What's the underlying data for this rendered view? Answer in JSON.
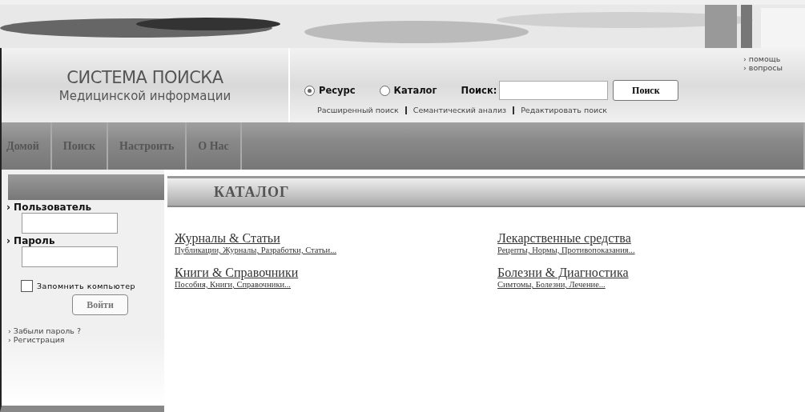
{
  "logo": {
    "title": "СИСТЕМА ПОИСКА",
    "subtitle": "Медицинской информации"
  },
  "help_links": [
    "› помощь",
    "› вопросы"
  ],
  "search": {
    "scopes": [
      {
        "label": "Ресурс",
        "selected": true
      },
      {
        "label": "Каталог",
        "selected": false
      }
    ],
    "label": "Поиск:",
    "button": "Поиск",
    "links": [
      "Расширенный поиск",
      "Семантический анализ",
      "Редактировать поиск"
    ]
  },
  "nav": [
    "Домой",
    "Поиск",
    "Настроить",
    "О Нас"
  ],
  "login": {
    "user_label": "› Пользователь",
    "password_label": "› Пароль",
    "remember": {
      "label": "Запомнить компьютер",
      "checked": false
    },
    "button": "Войти",
    "links": [
      "› Забыли пароль ?",
      "› Регистрация"
    ]
  },
  "catalog": {
    "title": "КАТАЛОГ",
    "items": [
      {
        "title": "Журналы & Статьи",
        "subtitle": "Публикации, Журналы, Разработки, Статьи..."
      },
      {
        "title": "Лекарственные средства",
        "subtitle": "Рецепты, Нормы, Противопоказания..."
      },
      {
        "title": "Книги & Справочники",
        "subtitle": "Пособия, Книги, Справочники..."
      },
      {
        "title": "Болезни & Диагностика",
        "subtitle": "Симтомы, Болезни, Лечение..."
      }
    ]
  }
}
